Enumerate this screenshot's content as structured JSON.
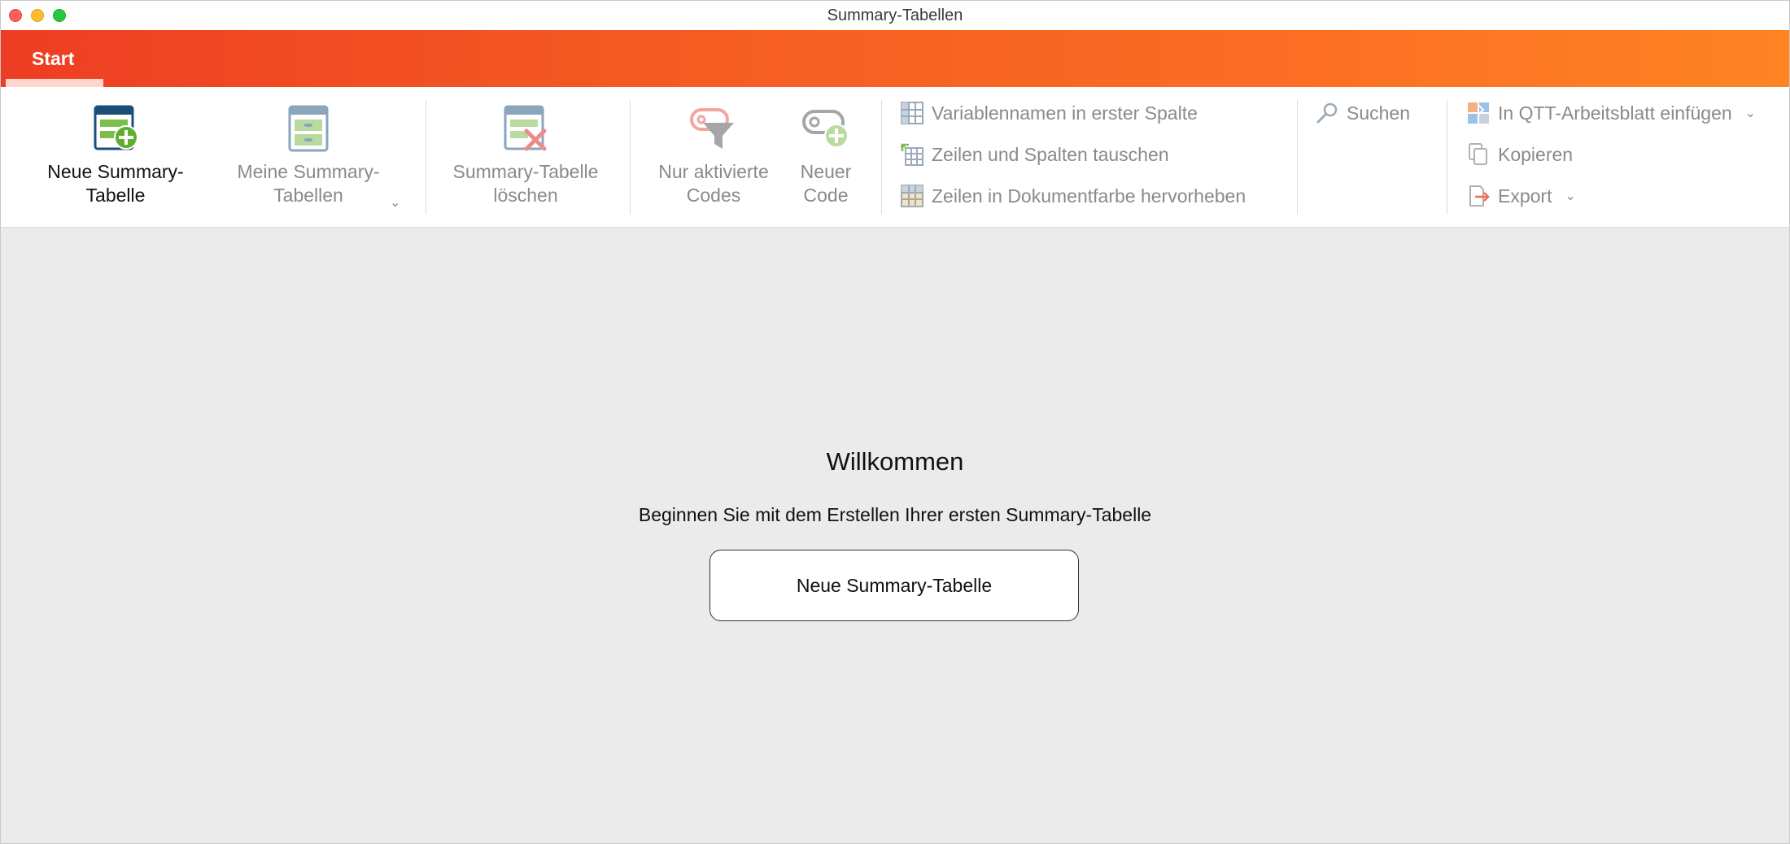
{
  "window": {
    "title": "Summary-Tabellen"
  },
  "tabs": [
    {
      "label": "Start",
      "active": true
    }
  ],
  "ribbon": {
    "new_table": {
      "label": "Neue Summary-\nTabelle",
      "icon": "table-add-icon"
    },
    "my_tables": {
      "label": "Meine Summary-\nTabellen",
      "icon": "table-list-icon"
    },
    "delete_table": {
      "label": "Summary-Tabelle\nlöschen",
      "icon": "table-delete-icon"
    },
    "active_codes": {
      "label": "Nur aktivierte\nCodes",
      "icon": "filter-codes-icon"
    },
    "new_code": {
      "label": "Neuer\nCode",
      "icon": "code-add-icon"
    },
    "options": [
      {
        "label": "Variablennamen in erster Spalte",
        "icon": "grid-first-column-icon"
      },
      {
        "label": "Zeilen und Spalten tauschen",
        "icon": "swap-rows-columns-icon"
      },
      {
        "label": "Zeilen in Dokumentfarbe hervorheben",
        "icon": "highlight-rows-icon"
      }
    ],
    "search": {
      "label": "Suchen",
      "icon": "search-icon"
    },
    "output": [
      {
        "label": "In QTT-Arbeitsblatt einfügen",
        "icon": "qtt-insert-icon",
        "dropdown": true
      },
      {
        "label": "Kopieren",
        "icon": "copy-icon",
        "dropdown": false
      },
      {
        "label": "Export",
        "icon": "export-icon",
        "dropdown": true
      }
    ]
  },
  "welcome": {
    "title": "Willkommen",
    "subtitle": "Beginnen Sie mit dem Erstellen Ihrer ersten Summary-Tabelle",
    "button_label": "Neue Summary-Tabelle"
  },
  "colors": {
    "accent_start": "#ee3d24",
    "accent_end": "#ff8424",
    "disabled_text": "#8a8a8a",
    "content_bg": "#ebebeb"
  }
}
